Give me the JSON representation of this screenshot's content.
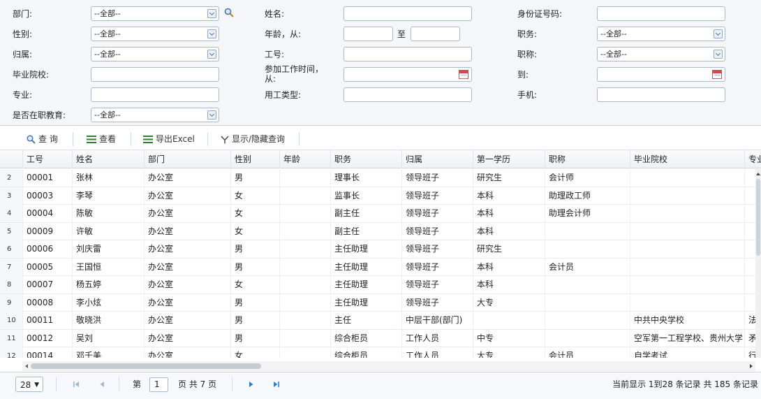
{
  "filters": {
    "dept_label": "部门:",
    "dept_value": "--全部--",
    "name_label": "姓名:",
    "idcard_label": "身份证号码:",
    "gender_label": "性别:",
    "gender_value": "--全部--",
    "age_label": "年龄，从:",
    "age_to_label": "至",
    "position_label": "职务:",
    "position_value": "--全部--",
    "belong_label": "归属:",
    "belong_value": "--全部--",
    "empno_label": "工号:",
    "title_label": "职称:",
    "title_value": "--全部--",
    "school_label": "毕业院校:",
    "workdate_label_1": "参加工作时间，",
    "workdate_label_2": "从:",
    "workdate_to_label": "到:",
    "major_label": "专业:",
    "emptype_label": "用工类型:",
    "mobile_label": "手机:",
    "oje_label": "是否在职教育:",
    "oje_value": "--全部--"
  },
  "toolbar": {
    "query": "查 询",
    "view": "查看",
    "export": "导出Excel",
    "toggle": "显示/隐藏查询"
  },
  "table": {
    "columns": [
      "工号",
      "姓名",
      "部门",
      "性别",
      "年龄",
      "职务",
      "归属",
      "第一学历",
      "职称",
      "毕业院校",
      "专业"
    ],
    "rows": [
      {
        "rn": "2",
        "c": [
          "00001",
          "张林",
          "办公室",
          "男",
          "",
          "理事长",
          "领导班子",
          "研究生",
          "会计师",
          "",
          ""
        ]
      },
      {
        "rn": "3",
        "c": [
          "00003",
          "李琴",
          "办公室",
          "女",
          "",
          "监事长",
          "领导班子",
          "本科",
          "助理政工师",
          "",
          ""
        ]
      },
      {
        "rn": "4",
        "c": [
          "00004",
          "陈敏",
          "办公室",
          "女",
          "",
          "副主任",
          "领导班子",
          "本科",
          "助理会计师",
          "",
          ""
        ]
      },
      {
        "rn": "5",
        "c": [
          "00009",
          "许敏",
          "办公室",
          "女",
          "",
          "副主任",
          "领导班子",
          "本科",
          "",
          "",
          ""
        ]
      },
      {
        "rn": "6",
        "c": [
          "00006",
          "刘庆雷",
          "办公室",
          "男",
          "",
          "主任助理",
          "领导班子",
          "研究生",
          "",
          "",
          ""
        ]
      },
      {
        "rn": "7",
        "c": [
          "00005",
          "王国恒",
          "办公室",
          "男",
          "",
          "主任助理",
          "领导班子",
          "本科",
          "会计员",
          "",
          ""
        ]
      },
      {
        "rn": "8",
        "c": [
          "00007",
          "杨五婷",
          "办公室",
          "女",
          "",
          "主任助理",
          "领导班子",
          "本科",
          "",
          "",
          ""
        ]
      },
      {
        "rn": "9",
        "c": [
          "00008",
          "李小炫",
          "办公室",
          "男",
          "",
          "主任助理",
          "领导班子",
          "大专",
          "",
          "",
          ""
        ]
      },
      {
        "rn": "10",
        "c": [
          "00011",
          "敬晓洪",
          "办公室",
          "男",
          "",
          "主任",
          "中层干部(部门)",
          "",
          "",
          "中共中央学校",
          "法"
        ]
      },
      {
        "rn": "11",
        "c": [
          "00012",
          "吴刘",
          "办公室",
          "男",
          "",
          "综合柜员",
          "工作人员",
          "中专",
          "",
          "空军第一工程学校、贵州大学",
          "矛"
        ]
      },
      {
        "rn": "12",
        "c": [
          "00014",
          "邓千美",
          "办公室",
          "女",
          "",
          "综合柜员",
          "工作人员",
          "大专",
          "会计员",
          "自学考试",
          "行"
        ]
      }
    ]
  },
  "pager": {
    "page_size": "28",
    "page_prefix": "第",
    "page_value": "1",
    "page_suffix": "页 共 7 页",
    "summary": "当前显示 1到28 条记录 共 185 条记录"
  }
}
